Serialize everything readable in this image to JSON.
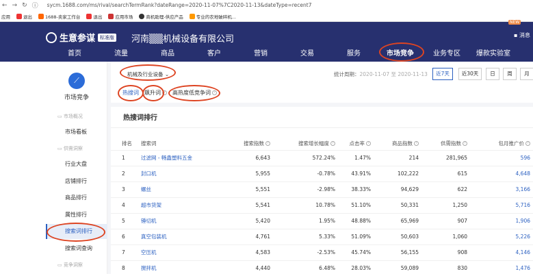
{
  "browser": {
    "url": "sycm.1688.com/ms/rival/searchTermRank?dateRange=2020-11-07%7C2020-11-13&dateType=recent7",
    "bookmarks": [
      "应用",
      "退出",
      "1688-卖家工作台",
      "退出",
      "应用市场",
      "商机助理-供应产品",
      "专业的农地破碎机..."
    ]
  },
  "header": {
    "logo": "生意参谋",
    "badge": "标准版",
    "company": "河南▒▒机械设备有限公司",
    "message": "消息",
    "nav": [
      "首页",
      "流量",
      "商品",
      "客户",
      "营销",
      "交易",
      "服务",
      "市场竞争",
      "业务专区",
      "爆款实验室"
    ],
    "active_nav": "市场竞争",
    "new_badge": "NEW"
  },
  "sidebar": {
    "title": "市场竞争",
    "groups": [
      {
        "label": "市场概况",
        "items": [
          "市场看板"
        ]
      },
      {
        "label": "供需洞察",
        "items": [
          "行业大盘",
          "店铺排行",
          "商品排行",
          "属性排行",
          "搜索词排行",
          "搜索词查询"
        ]
      },
      {
        "label": "竞争洞察",
        "items": []
      }
    ],
    "active_item": "搜索词排行"
  },
  "toolbar": {
    "industry": "机械及行业设备",
    "period_label": "统计周期：",
    "period_value": "2020-11-07 至 2020-11-13",
    "buttons": [
      "近7天",
      "近30天",
      "日",
      "周",
      "月"
    ]
  },
  "tabs": [
    "热搜词",
    "飙升词",
    "高热度低竞争词"
  ],
  "section_title": "热搜词排行",
  "table": {
    "columns": [
      "排名",
      "搜索词",
      "搜索指数",
      "搜索增长幅度",
      "点击率",
      "商品指数",
      "供需指数",
      "包月推广价"
    ],
    "rows": [
      [
        "1",
        "过滤网 - 畅鑫塑料五金",
        "6,643",
        "572.24%",
        "1.47%",
        "214",
        "281,965",
        "596"
      ],
      [
        "2",
        "封口机",
        "5,955",
        "-0.78%",
        "43.91%",
        "102,222",
        "615",
        "4,648"
      ],
      [
        "3",
        "螺丝",
        "5,551",
        "-2.98%",
        "38.33%",
        "94,629",
        "622",
        "3,166"
      ],
      [
        "4",
        "超市货架",
        "5,541",
        "10.78%",
        "51.10%",
        "50,331",
        "1,250",
        "5,716"
      ],
      [
        "5",
        "锤切机",
        "5,420",
        "1.95%",
        "48.88%",
        "65,969",
        "907",
        "1,906"
      ],
      [
        "6",
        "真空包装机",
        "4,761",
        "5.33%",
        "51.09%",
        "50,603",
        "1,060",
        "5,226"
      ],
      [
        "7",
        "空压机",
        "4,583",
        "-2.53%",
        "45.74%",
        "56,155",
        "908",
        "4,146"
      ],
      [
        "8",
        "搅拌机",
        "4,440",
        "6.48%",
        "28.03%",
        "59,089",
        "830",
        "1,476"
      ]
    ]
  }
}
